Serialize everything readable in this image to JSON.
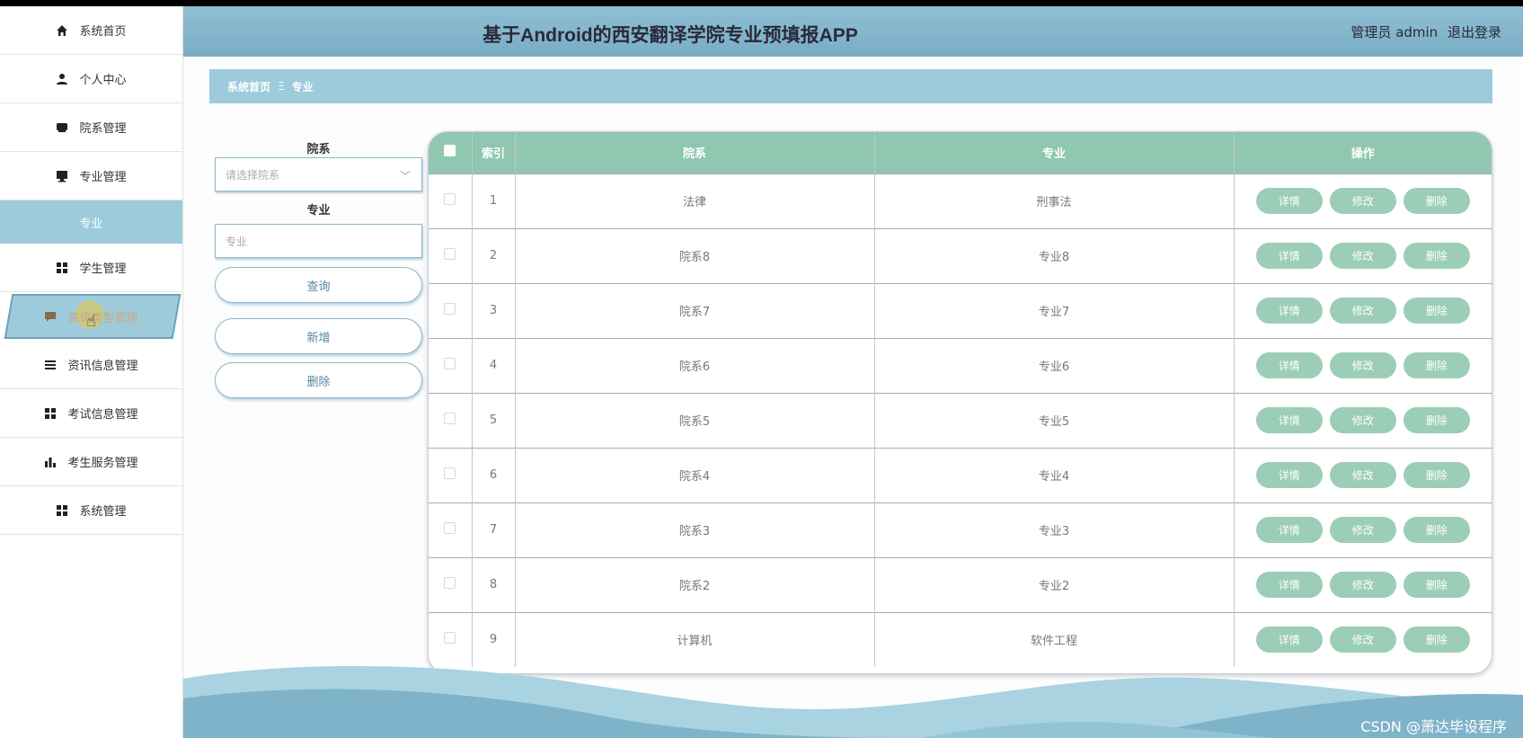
{
  "app": {
    "title": "基于Android的西安翻译学院专业预填报APP",
    "user_role": "管理员 admin",
    "logout_label": "退出登录"
  },
  "sidebar": {
    "items": [
      {
        "label": "系统首页",
        "icon": "home-icon"
      },
      {
        "label": "个人中心",
        "icon": "user-icon"
      },
      {
        "label": "院系管理",
        "icon": "building-icon"
      },
      {
        "label": "专业管理",
        "icon": "monitor-icon"
      },
      {
        "label": "专业",
        "icon": ""
      },
      {
        "label": "学生管理",
        "icon": "grid-icon"
      },
      {
        "label": "资讯类型管理",
        "icon": "chat-icon"
      },
      {
        "label": "资讯信息管理",
        "icon": "list-icon"
      },
      {
        "label": "考试信息管理",
        "icon": "grid-icon"
      },
      {
        "label": "考生服务管理",
        "icon": "bar-chart-icon"
      },
      {
        "label": "系统管理",
        "icon": "grid-icon"
      }
    ]
  },
  "breadcrumb": {
    "home": "系统首页",
    "separator": "Ξ",
    "current": "专业"
  },
  "search": {
    "dept_label": "院系",
    "dept_placeholder": "请选择院系",
    "major_label": "专业",
    "major_placeholder": "专业",
    "query_label": "查询",
    "add_label": "新增",
    "delete_label": "删除"
  },
  "table": {
    "headers": {
      "index": "索引",
      "dept": "院系",
      "major": "专业",
      "ops": "操作"
    },
    "actions": {
      "detail": "详情",
      "edit": "修改",
      "delete": "删除"
    },
    "rows": [
      {
        "index": "1",
        "dept": "法律",
        "major": "刑事法"
      },
      {
        "index": "2",
        "dept": "院系8",
        "major": "专业8"
      },
      {
        "index": "3",
        "dept": "院系7",
        "major": "专业7"
      },
      {
        "index": "4",
        "dept": "院系6",
        "major": "专业6"
      },
      {
        "index": "5",
        "dept": "院系5",
        "major": "专业5"
      },
      {
        "index": "6",
        "dept": "院系4",
        "major": "专业4"
      },
      {
        "index": "7",
        "dept": "院系3",
        "major": "专业3"
      },
      {
        "index": "8",
        "dept": "院系2",
        "major": "专业2"
      },
      {
        "index": "9",
        "dept": "计算机",
        "major": "软件工程"
      }
    ]
  },
  "watermark": "CSDN @萧达毕设程序",
  "colors": {
    "accent": "#9ecbdb",
    "table_header": "#8fc7b0",
    "action_button": "#9ccdb7",
    "topbar": "#7fb3ca"
  }
}
